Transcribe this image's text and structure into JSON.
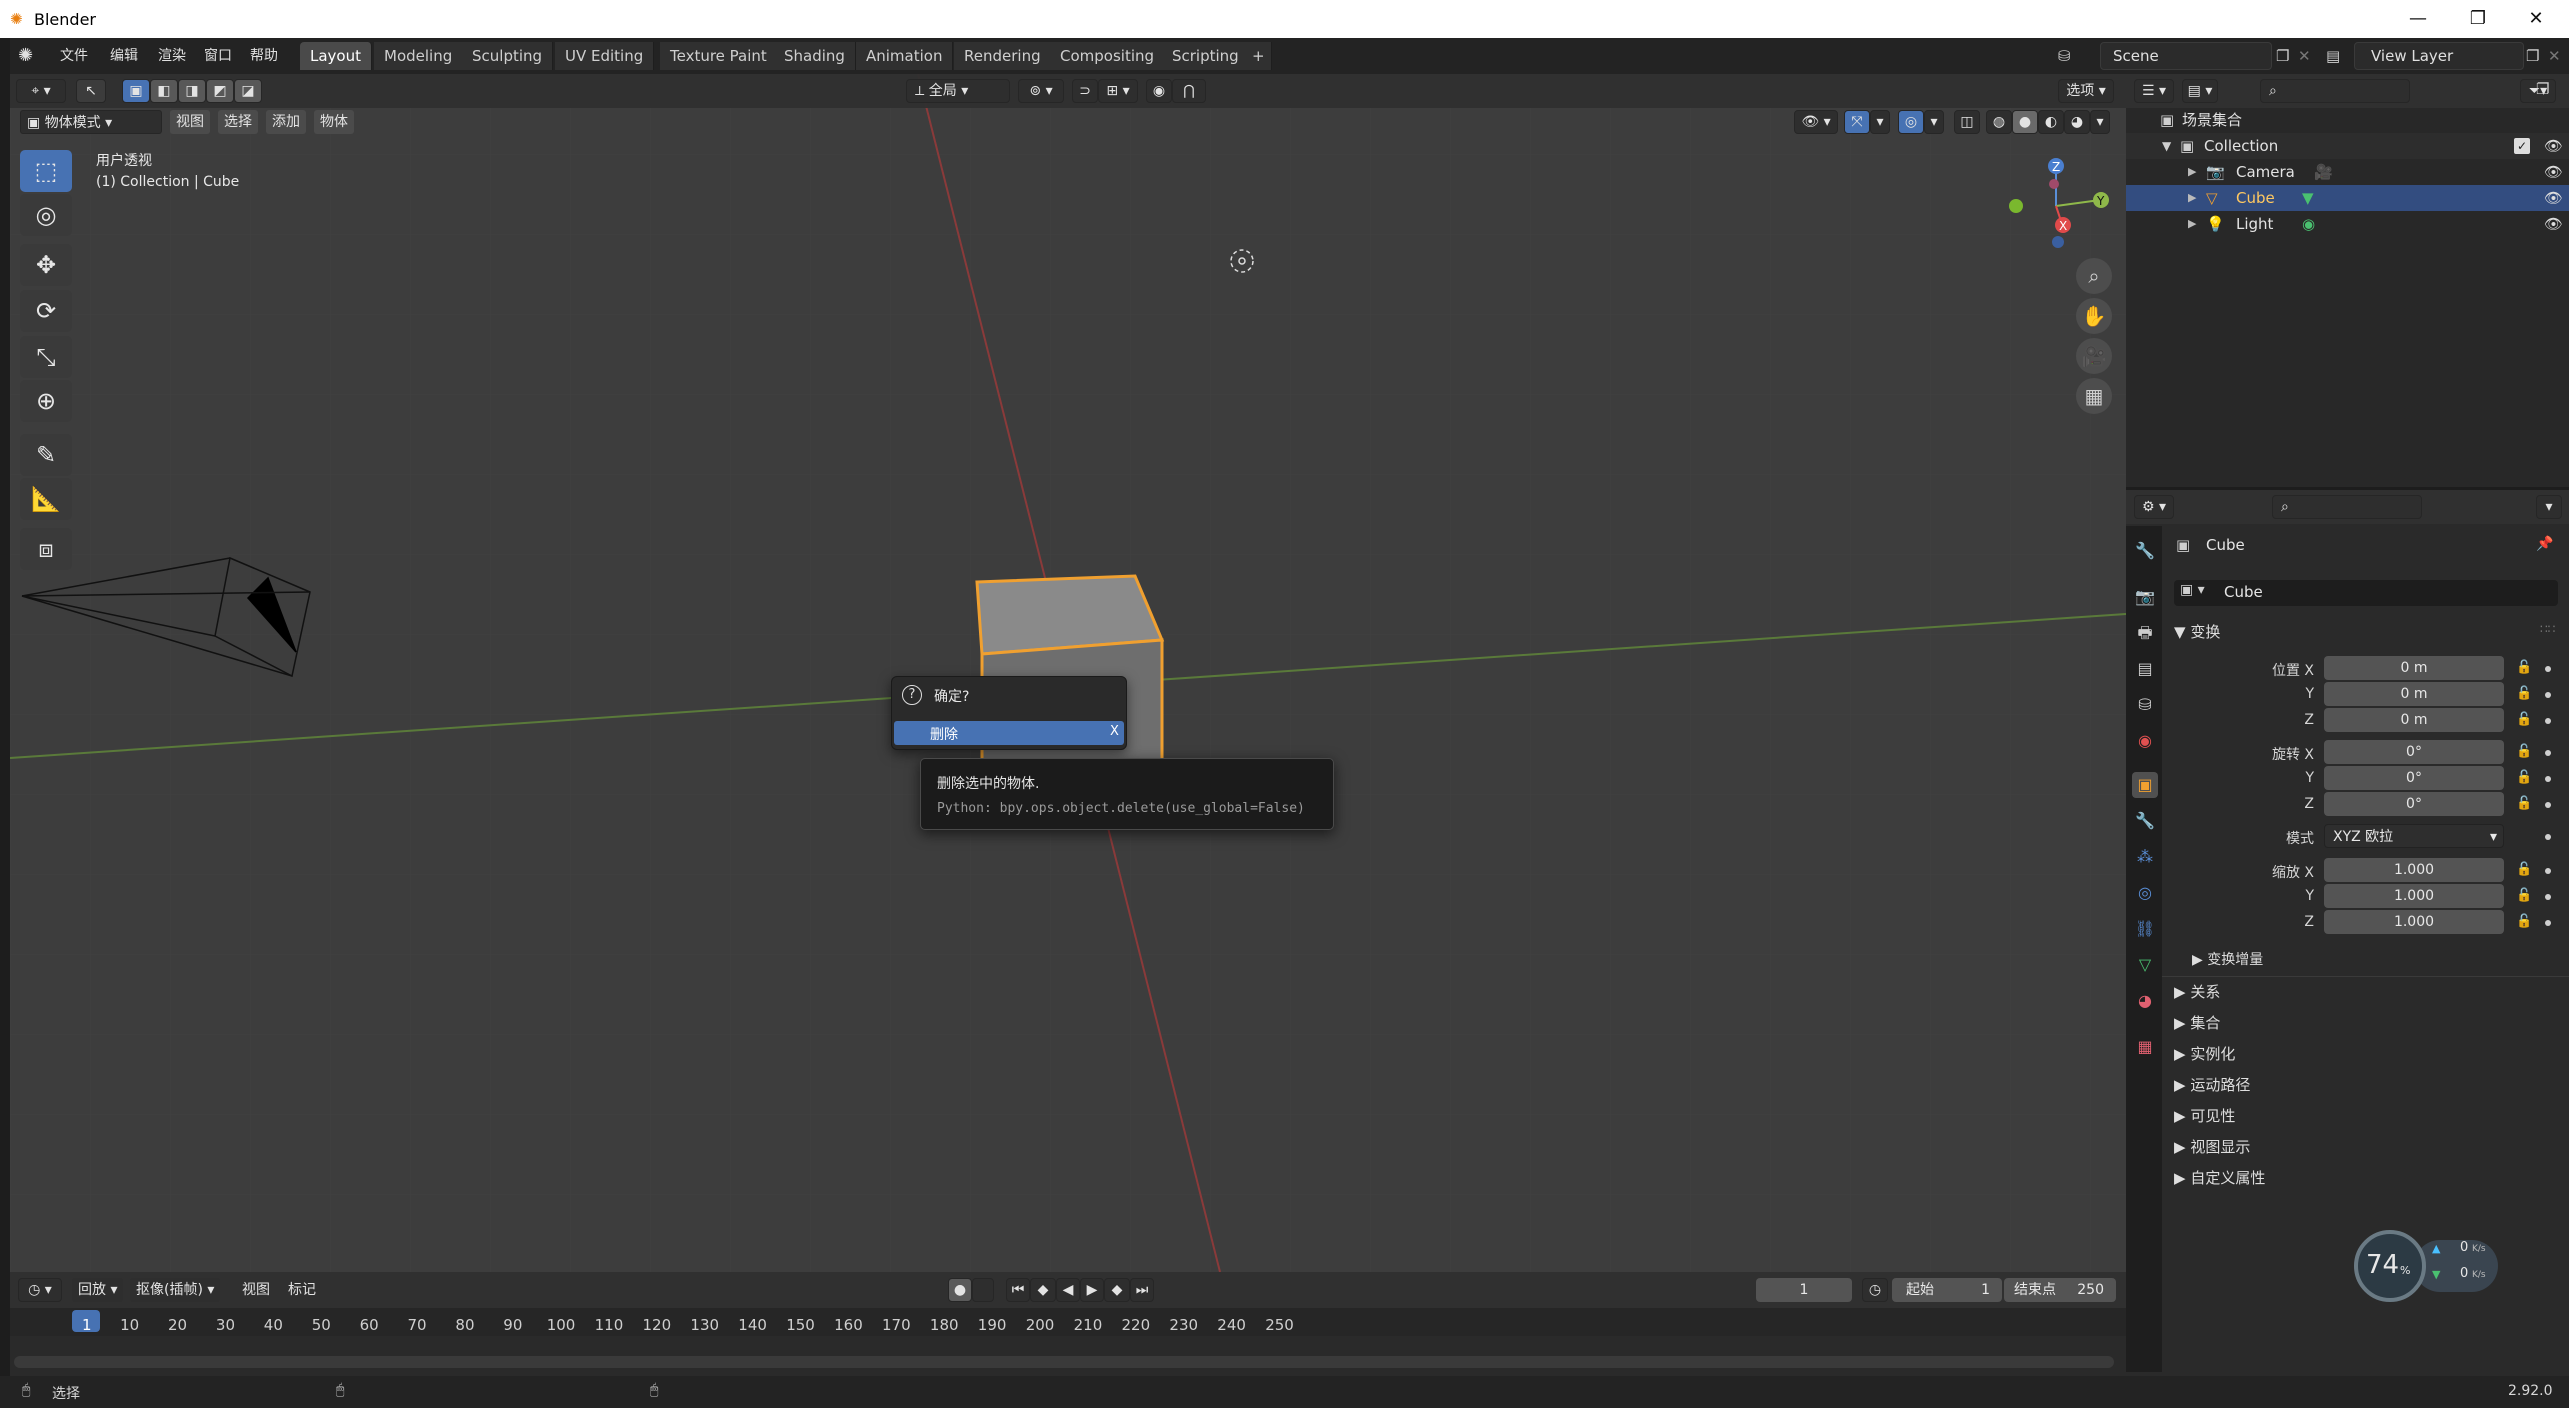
{
  "window": {
    "title": "Blender",
    "controls": [
      "—",
      "❐",
      "✕"
    ]
  },
  "menus": [
    "文件",
    "编辑",
    "渲染",
    "窗口",
    "帮助"
  ],
  "workspaces": [
    "Layout",
    "Modeling",
    "Sculpting",
    "UV Editing",
    "Texture Paint",
    "Shading",
    "Animation",
    "Rendering",
    "Compositing",
    "Scripting"
  ],
  "workspace_add": "+",
  "scene": {
    "name": "Scene",
    "view_layer": "View Layer"
  },
  "viewport": {
    "mode": "物体模式",
    "menus": [
      "视图",
      "选择",
      "添加",
      "物体"
    ],
    "orientation": "全局",
    "options": "选项",
    "info_line1": "用户透视",
    "info_line2": "(1) Collection | Cube",
    "gizmo": {
      "z": "Z",
      "y": "Y",
      "x": "X"
    }
  },
  "outliner": {
    "root": "场景集合",
    "collection": "Collection",
    "items": [
      {
        "name": "Camera",
        "selected": false
      },
      {
        "name": "Cube",
        "selected": true
      },
      {
        "name": "Light",
        "selected": false
      }
    ]
  },
  "properties": {
    "object_name": "Cube",
    "name_field": "Cube",
    "transform_title": "变换",
    "location_label": "位置 X",
    "location": [
      "0 m",
      "0 m",
      "0 m"
    ],
    "rotation_label": "旋转 X",
    "rotation": [
      "0°",
      "0°",
      "0°"
    ],
    "mode_label": "模式",
    "mode_value": "XYZ 欧拉",
    "scale_label": "缩放 X",
    "scale": [
      "1.000",
      "1.000",
      "1.000"
    ],
    "axis_y": "Y",
    "axis_z": "Z",
    "delta": "变换增量",
    "sections": [
      "关系",
      "集合",
      "实例化",
      "运动路径",
      "可见性",
      "视图显示",
      "自定义属性"
    ]
  },
  "confirm_dialog": {
    "title": "确定?",
    "action": "删除",
    "close": "X"
  },
  "tooltip": {
    "description": "删除选中的物体.",
    "python": "Python: bpy.ops.object.delete(use_global=False)"
  },
  "timeline": {
    "playback": "回放",
    "keying": "抠像(插帧)",
    "view": "视图",
    "marker": "标记",
    "current_frame": "1",
    "start_label": "起始",
    "start": "1",
    "end_label": "结束点",
    "end": "250",
    "ticks": [
      "1",
      "10",
      "20",
      "30",
      "40",
      "50",
      "60",
      "70",
      "80",
      "90",
      "100",
      "110",
      "120",
      "130",
      "140",
      "150",
      "160",
      "170",
      "180",
      "190",
      "200",
      "210",
      "220",
      "230",
      "240",
      "250"
    ]
  },
  "status": {
    "select": "选择",
    "version": "2.92.0"
  },
  "net_widget": {
    "cpu": "74",
    "unit": "%",
    "up": "0",
    "down": "0",
    "speed_unit": "K/s"
  },
  "colors": {
    "selection": "#4772b3",
    "accent_orange": "#f0a030",
    "viewport_bg": "#3d3d3d"
  }
}
